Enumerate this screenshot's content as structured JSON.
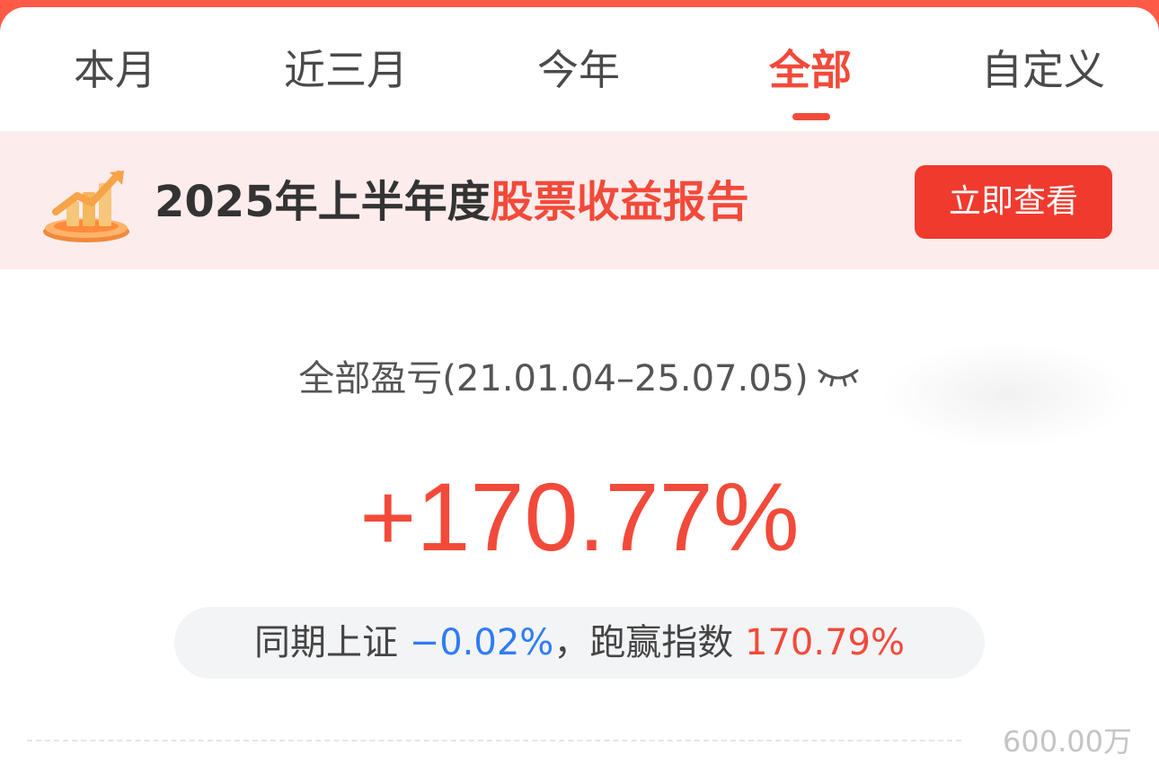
{
  "tabs": [
    {
      "label": "本月",
      "active": false
    },
    {
      "label": "近三月",
      "active": false
    },
    {
      "label": "今年",
      "active": false
    },
    {
      "label": "全部",
      "active": true
    },
    {
      "label": "自定义",
      "active": false
    }
  ],
  "banner": {
    "icon": "report-trophy-icon",
    "text_plain": "2025年上半年度",
    "text_highlight": "股票收益报告",
    "button_label": "立即查看"
  },
  "summary": {
    "label": "全部盈亏(21.01.04–25.07.05)",
    "eye_icon": "eye-closed-icon",
    "value": "+170.77%"
  },
  "compare": {
    "prefix": "同期上证",
    "index_value": "−0.02%",
    "separator": "，",
    "beat_label": "跑赢指数",
    "beat_value": "170.79%"
  },
  "chart": {
    "axis_top_label": "600.00万"
  },
  "colors": {
    "accent": "#f24a3a",
    "negative": "#2f7cf6",
    "banner_bg": "#fdecec",
    "top_bar": "#ff5a46"
  }
}
